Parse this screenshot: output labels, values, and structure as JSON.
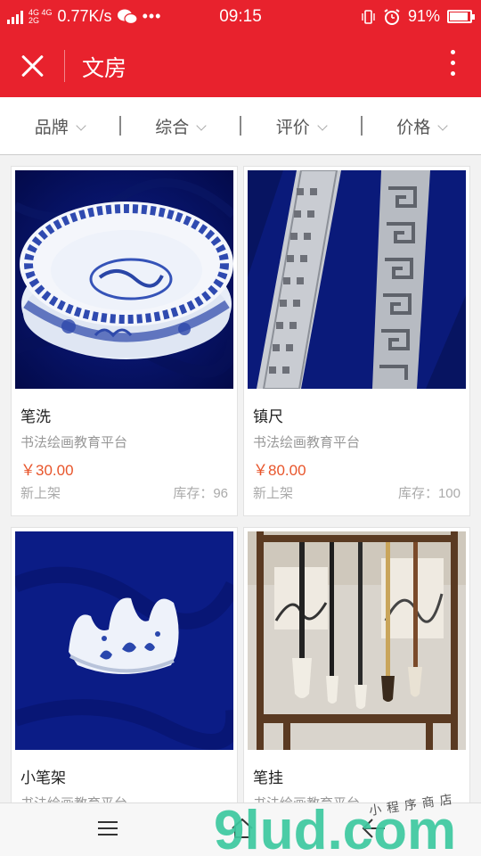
{
  "status_bar": {
    "net_label": "2G",
    "net_label2": "4G 4G",
    "net_label3": "2G",
    "speed": "0.77K/s",
    "more": "•••",
    "time": "09:15",
    "battery": "91%",
    "battery_level": 0.91
  },
  "header": {
    "title": "文房",
    "close_icon": "close-icon",
    "more_icon": "more-vertical-icon"
  },
  "filters": [
    {
      "label": "品牌"
    },
    {
      "label": "综合"
    },
    {
      "label": "评价"
    },
    {
      "label": "价格"
    }
  ],
  "products": [
    {
      "name": "笔洗",
      "vendor": "书法绘画教育平台",
      "price": "￥30.00",
      "tag": "新上架",
      "stock": "库存：96"
    },
    {
      "name": "镇尺",
      "vendor": "书法绘画教育平台",
      "price": "￥80.00",
      "tag": "新上架",
      "stock": "库存：100"
    },
    {
      "name": "小笔架",
      "vendor": "书法绘画教育平台",
      "price": "",
      "tag": "",
      "stock": ""
    },
    {
      "name": "笔挂",
      "vendor": "书法绘画教育平台",
      "price": "",
      "tag": "",
      "stock": ""
    }
  ],
  "watermark": {
    "logo": "9lud.com",
    "caption": "小程序商店"
  },
  "colors": {
    "brand_red": "#e8222d",
    "price_orange": "#e8552b",
    "watermark_green": "#3dc9a0"
  }
}
